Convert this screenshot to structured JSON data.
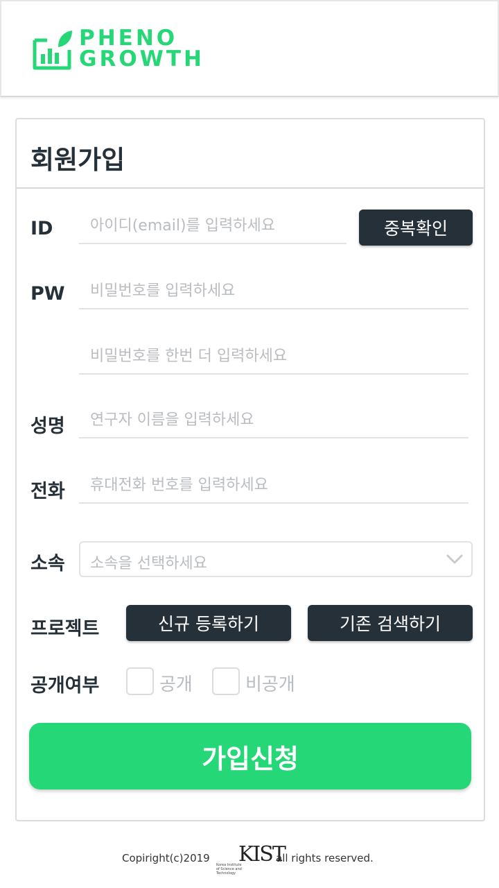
{
  "header": {
    "logo_line1": "PHENO",
    "logo_line2": "GROWTH",
    "brand_color": "#25d776"
  },
  "form": {
    "title": "회원가입",
    "id": {
      "label": "ID",
      "placeholder": "아이디(email)를 입력하세요",
      "check_button": "중복확인"
    },
    "pw": {
      "label": "PW",
      "placeholder": "비밀번호를 입력하세요",
      "confirm_placeholder": "비밀번호를 한번 더 입력하세요"
    },
    "name": {
      "label": "성명",
      "placeholder": "연구자 이름을 입력하세요"
    },
    "phone": {
      "label": "전화",
      "placeholder": "휴대전화 번호를 입력하세요"
    },
    "affiliation": {
      "label": "소속",
      "selected": "소속을 선택하세요"
    },
    "project": {
      "label": "프로젝트",
      "new_button": "신규 등록하기",
      "search_button": "기존 검색하기"
    },
    "visibility": {
      "label": "공개여부",
      "public_label": "공개",
      "private_label": "비공개"
    },
    "submit": "가입신청",
    "button_color": "#263038"
  },
  "footer": {
    "copyright": "Copiright(c)2019",
    "kist_logo": "KIST",
    "kist_subtitle": "Korea Institute of Science and Technology",
    "rights": "all rights reserved."
  },
  "icons": [
    "chart-leaf-logo-icon",
    "chevron-down-icon"
  ]
}
